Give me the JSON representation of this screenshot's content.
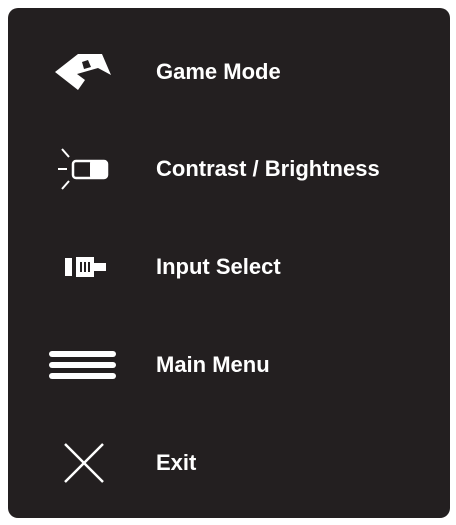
{
  "menu": {
    "items": [
      {
        "label": "Game Mode",
        "icon": "game-mode-icon"
      },
      {
        "label": "Contrast / Brightness",
        "icon": "contrast-brightness-icon"
      },
      {
        "label": "Input Select",
        "icon": "input-select-icon"
      },
      {
        "label": "Main Menu",
        "icon": "main-menu-icon"
      },
      {
        "label": "Exit",
        "icon": "exit-icon"
      }
    ]
  },
  "colors": {
    "panel_background": "#231f20",
    "text": "#ffffff",
    "icon": "#ffffff",
    "page_background": "#ffffff"
  }
}
